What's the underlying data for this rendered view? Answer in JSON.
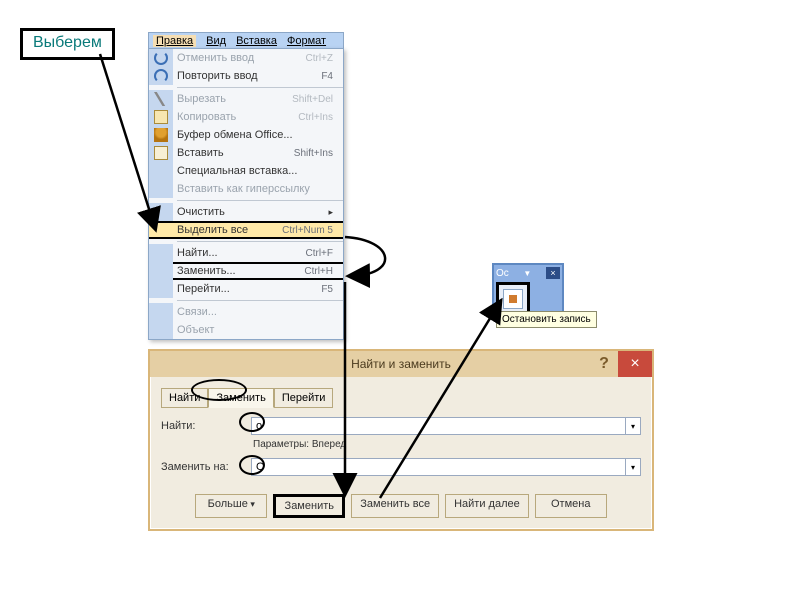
{
  "callout": "Выберем",
  "menubar": {
    "items": [
      "Правка",
      "Вид",
      "Вставка",
      "Формат"
    ]
  },
  "menu": {
    "undo": {
      "label": "Отменить ввод",
      "key": "Ctrl+Z"
    },
    "redo": {
      "label": "Повторить ввод",
      "key": "F4"
    },
    "cut": {
      "label": "Вырезать",
      "key": "Shift+Del"
    },
    "copy": {
      "label": "Копировать",
      "key": "Ctrl+Ins"
    },
    "office_clip": {
      "label": "Буфер обмена Office..."
    },
    "paste": {
      "label": "Вставить",
      "key": "Shift+Ins"
    },
    "paste_spec": {
      "label": "Специальная вставка..."
    },
    "paste_link": {
      "label": "Вставить как гиперссылку"
    },
    "clear": {
      "label": "Очистить"
    },
    "select_all": {
      "label": "Выделить все",
      "key": "Ctrl+Num 5"
    },
    "find": {
      "label": "Найти...",
      "key": "Ctrl+F"
    },
    "replace": {
      "label": "Заменить...",
      "key": "Ctrl+H"
    },
    "goto": {
      "label": "Перейти...",
      "key": "F5"
    },
    "links": {
      "label": "Связи..."
    },
    "object": {
      "label": "Объект"
    }
  },
  "macro": {
    "title": "Ос",
    "close": "×",
    "tooltip": "Остановить запись"
  },
  "dlg": {
    "title": "Найти и заменить",
    "help": "?",
    "close": "×",
    "tabs": {
      "find": "Найти",
      "replace": "Заменить",
      "goto": "Перейти"
    },
    "find_label": "Найти:",
    "find_value": "о",
    "options_label": "Параметры:",
    "options_value": "Вперед",
    "replace_label": "Заменить на:",
    "replace_value": "О",
    "buttons": {
      "more": "Больше",
      "replace": "Заменить",
      "replace_all": "Заменить все",
      "find_next": "Найти далее",
      "cancel": "Отмена"
    }
  }
}
